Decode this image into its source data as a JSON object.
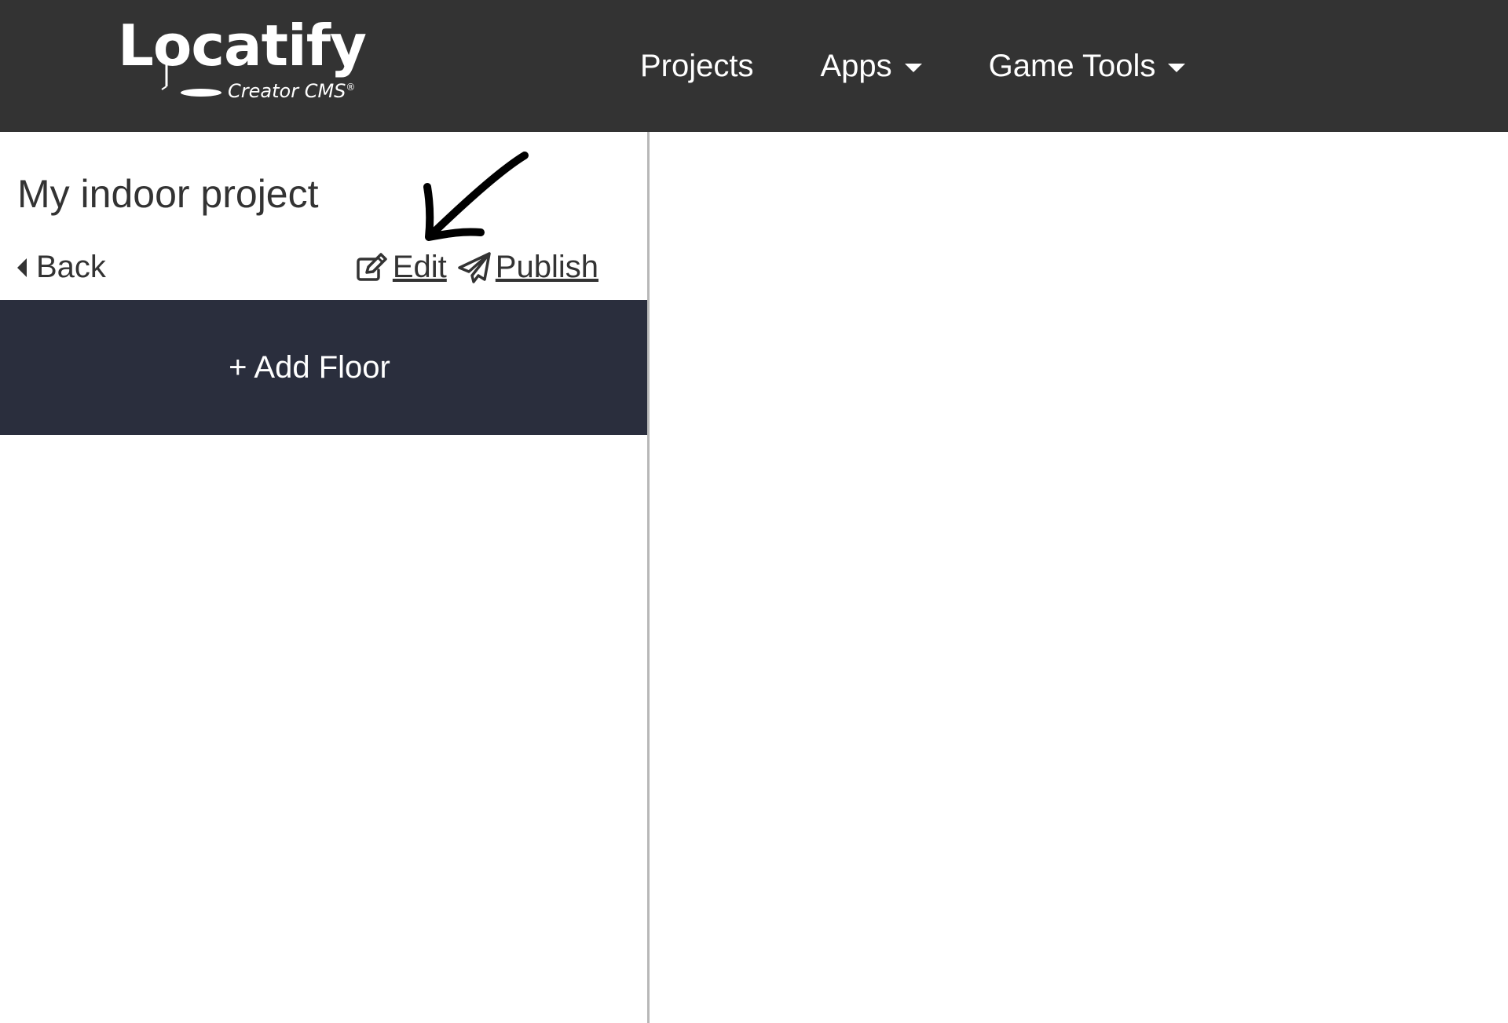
{
  "brand": {
    "logo_text": "Locatify",
    "logo_subtitle": "Creator CMS",
    "logo_trademark": "®"
  },
  "nav": {
    "items": [
      {
        "label": "Projects",
        "has_dropdown": false
      },
      {
        "label": "Apps",
        "has_dropdown": true
      },
      {
        "label": "Game Tools",
        "has_dropdown": true
      }
    ]
  },
  "sidebar": {
    "project_title": "My indoor project",
    "back_label": "Back",
    "edit_label": "Edit",
    "publish_label": "Publish",
    "add_floor_label": "+ Add Floor"
  },
  "colors": {
    "navbar_bg": "#333333",
    "add_floor_bg": "#2a2e3d",
    "text": "#333333",
    "divider": "#b8b8b8"
  },
  "icons": {
    "back": "caret-left-icon",
    "edit": "edit-icon",
    "publish": "paper-plane-icon",
    "dropdown": "caret-down-icon",
    "annotation": "arrow-annotation-icon"
  }
}
